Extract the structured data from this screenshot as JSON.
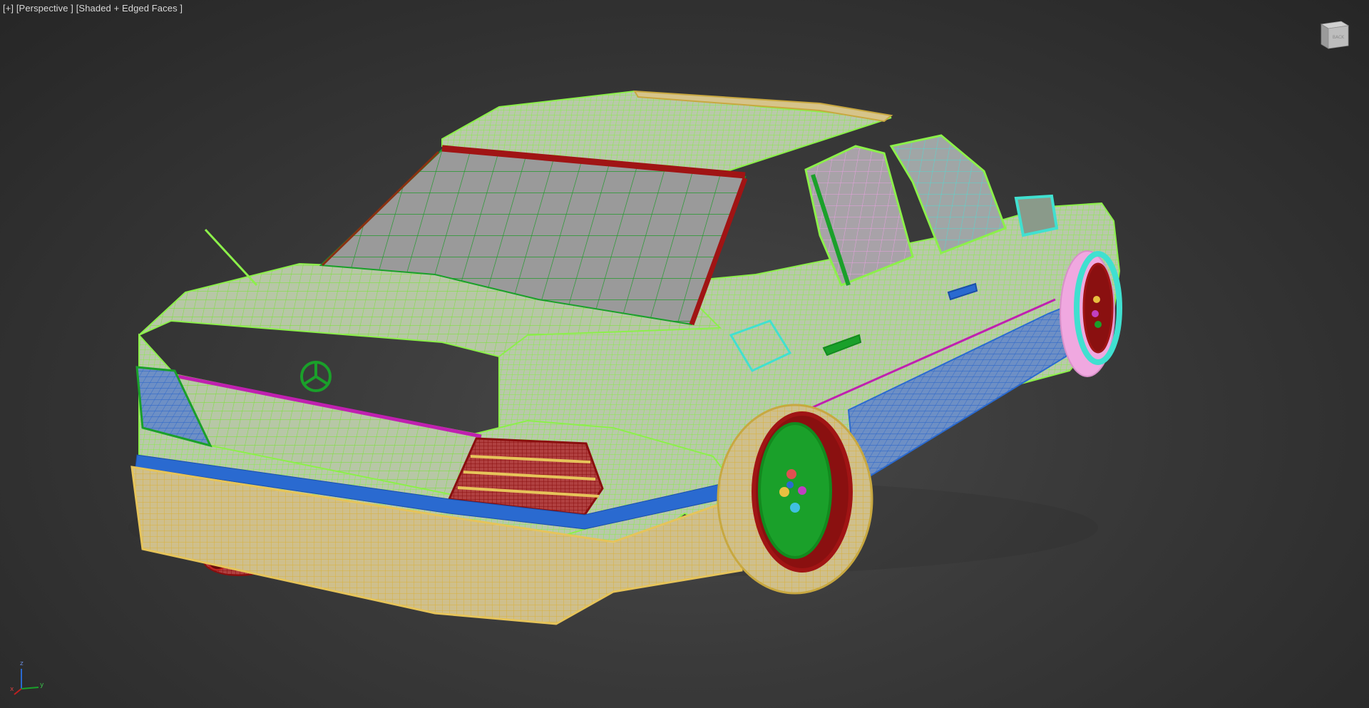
{
  "viewport": {
    "menu": "[+]",
    "view": "[Perspective ]",
    "shading": "[Shaded + Edged Faces ]"
  },
  "viewcube": {
    "face_label": "BACK"
  },
  "axis": {
    "x": "x",
    "y": "y",
    "z": "z"
  },
  "colors": {
    "background_center": "#4a4a4a",
    "background_edge": "#262626",
    "body_wire": "#8cf04a",
    "bumper": "#e6c45a",
    "trim_red": "#b01818",
    "trim_blue": "#2a6ad0",
    "trim_magenta": "#c020b0",
    "wheel_red": "#a01414",
    "wheel_green": "#1aa02a",
    "cyan": "#40e0d0",
    "pink": "#f0a8e0"
  },
  "icons": [
    "viewcube-icon",
    "axis-tripod-icon"
  ]
}
